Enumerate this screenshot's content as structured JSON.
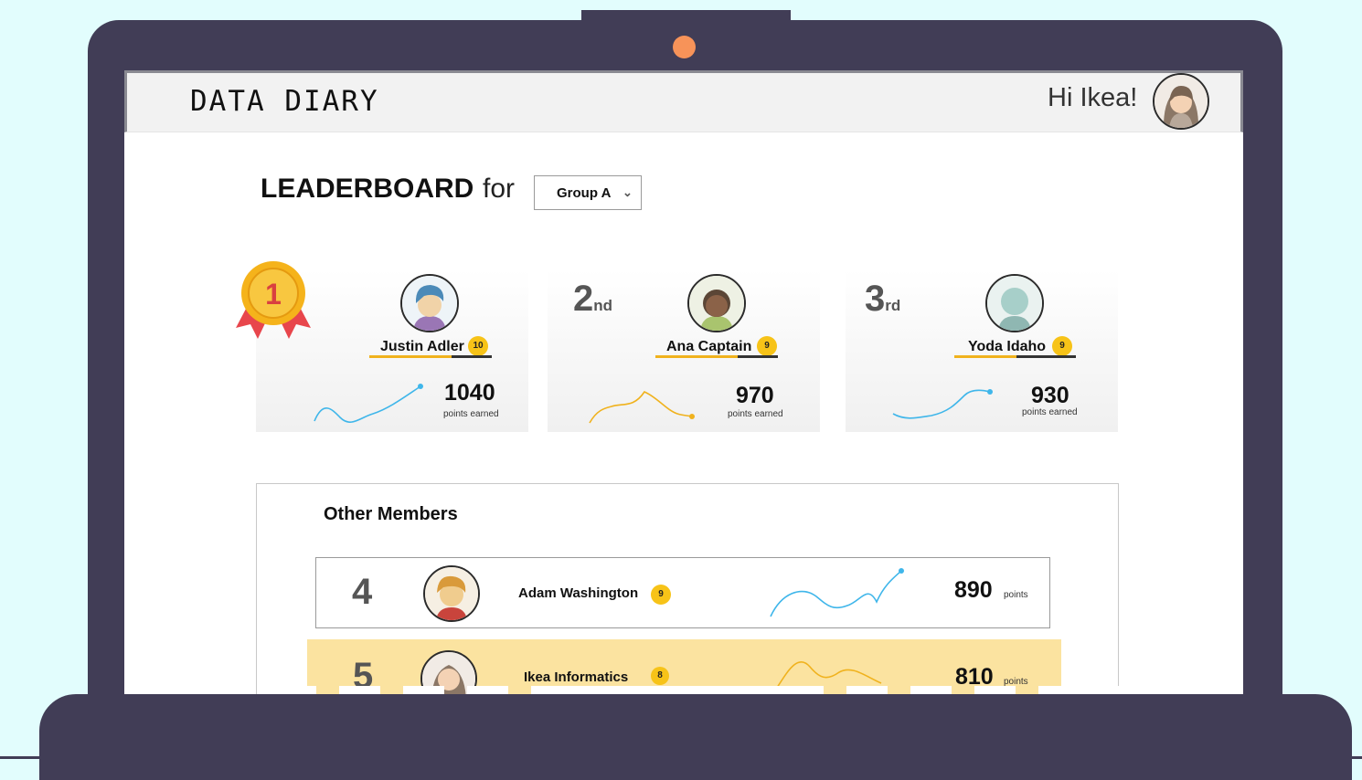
{
  "app": {
    "brand": "DATA DIARY",
    "greeting": "Hi Ikea!"
  },
  "leaderboard": {
    "title": "LEADERBOARD",
    "for_label": "for",
    "group_selected": "Group A"
  },
  "podium": [
    {
      "rank": "1",
      "name": "Justin Adler",
      "level": "10",
      "points": "1040",
      "points_label": "points earned",
      "trend_color": "#3fb6ea"
    },
    {
      "rank": "2",
      "rank_suffix": "nd",
      "name": "Ana Captain",
      "level": "9",
      "points": "970",
      "points_label": "points earned",
      "trend_color": "#f0b21d"
    },
    {
      "rank": "3",
      "rank_suffix": "rd",
      "name": "Yoda Idaho",
      "level": "9",
      "points": "930",
      "points_label": "points earned",
      "trend_color": "#3fb6ea"
    }
  ],
  "others": {
    "title": "Other Members",
    "rows": [
      {
        "rank": "4",
        "name": "Adam Washington",
        "level": "9",
        "points": "890",
        "unit": "points",
        "highlighted": false
      },
      {
        "rank": "5",
        "name": "Ikea Informatics",
        "level": "8",
        "points": "810",
        "unit": "points",
        "highlighted": true
      }
    ]
  },
  "colors": {
    "frame": "#413d56",
    "background": "#e2fdfd",
    "camera": "#f79359",
    "badge": "#f7c318",
    "highlight_row": "#fbe3a0",
    "trend_blue": "#3fb6ea",
    "trend_yellow": "#f0b21d"
  }
}
